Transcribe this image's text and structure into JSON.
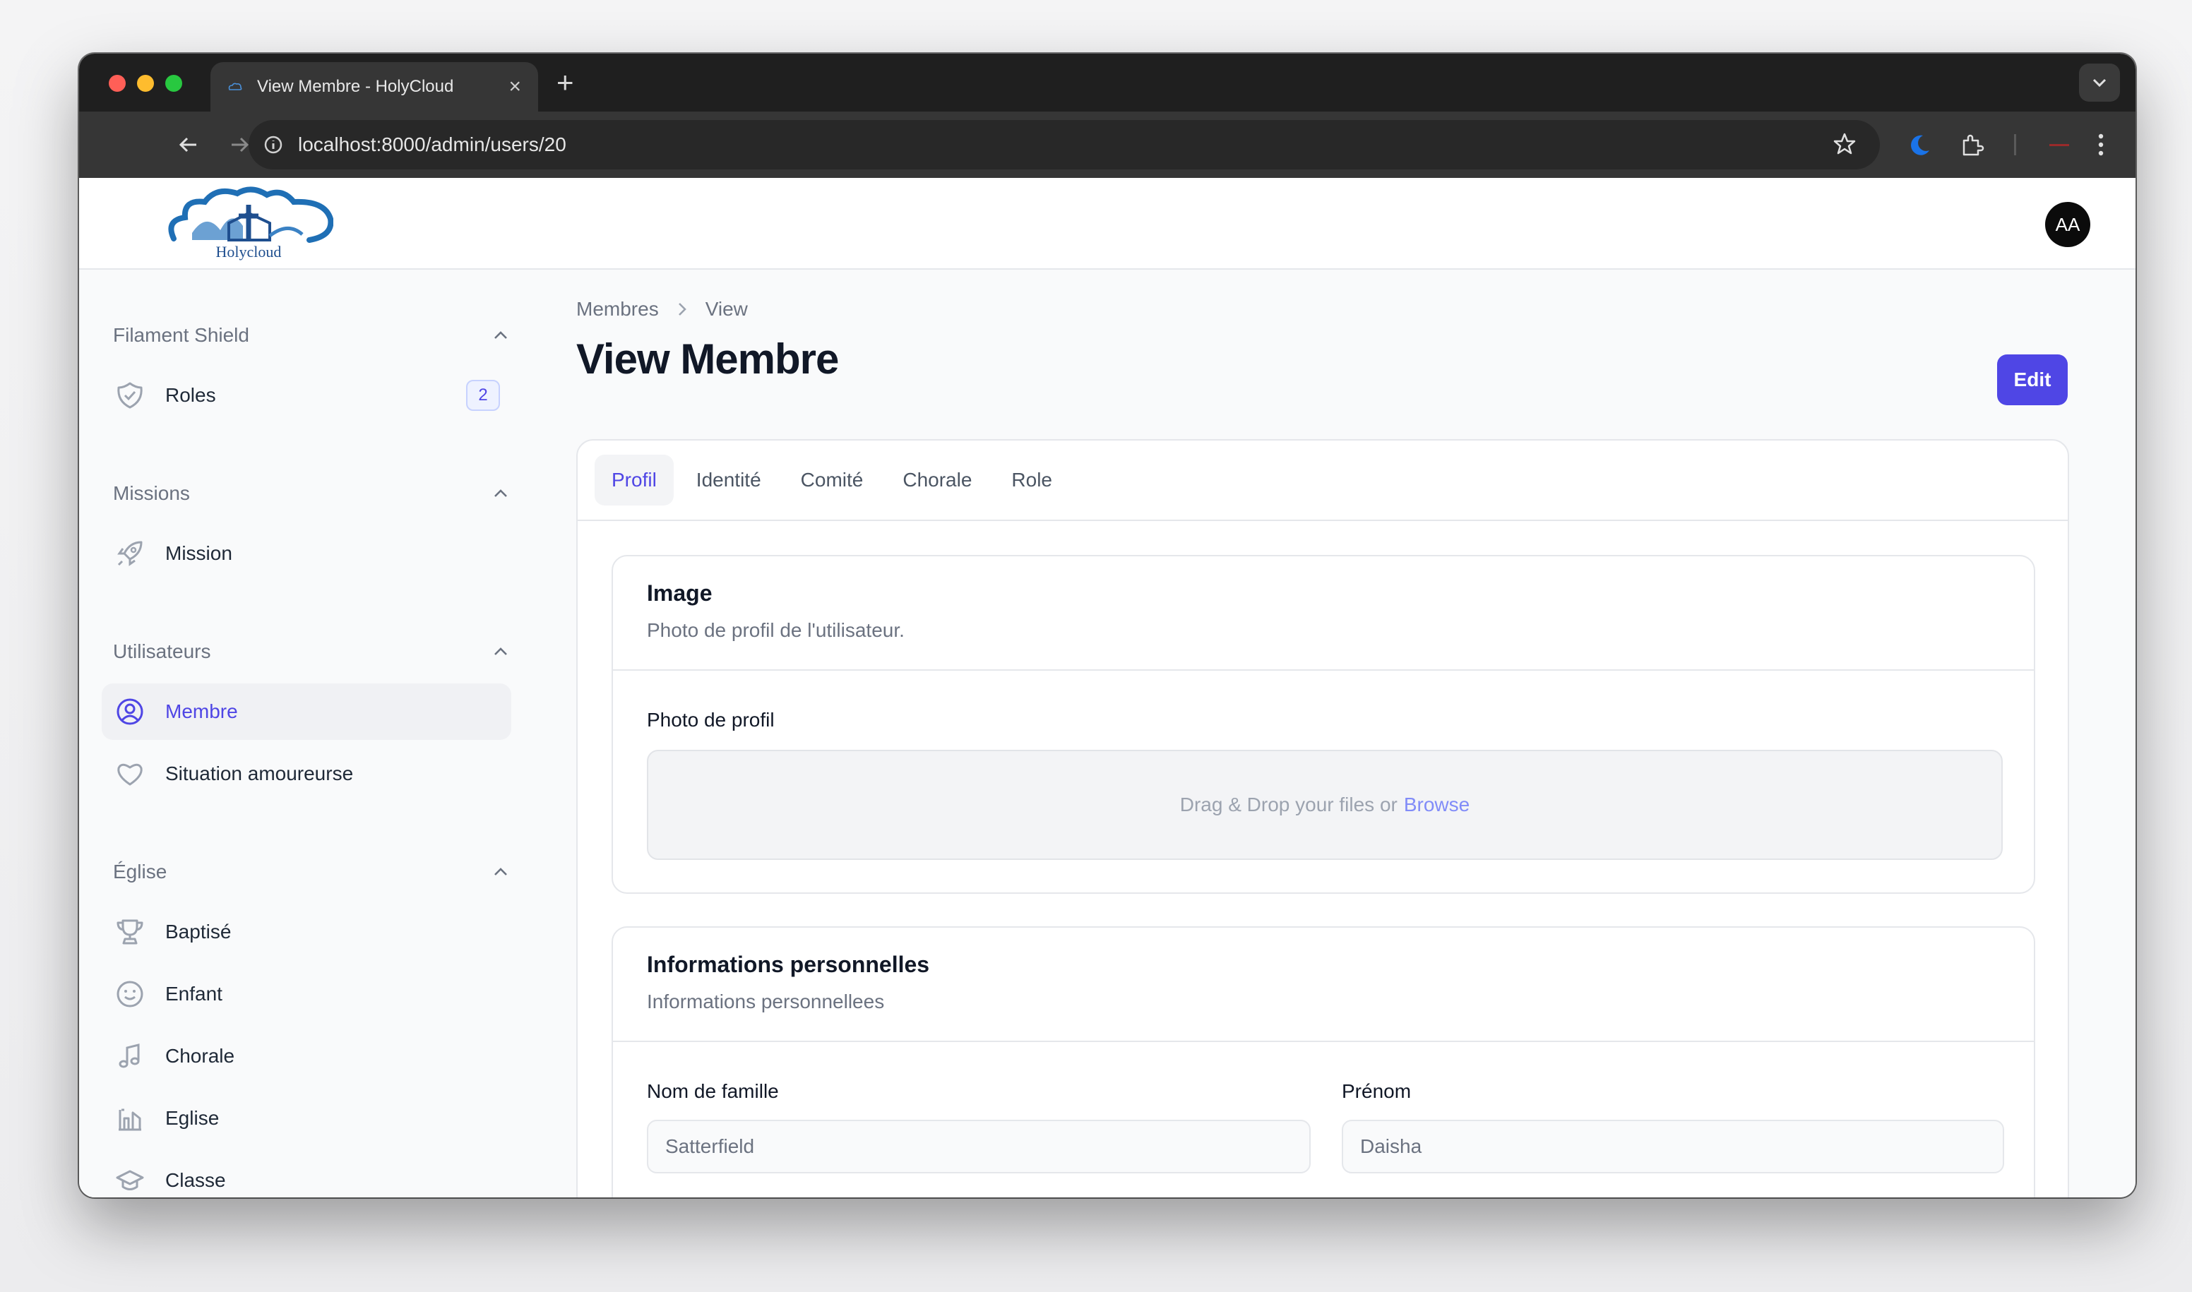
{
  "browser": {
    "tab_title": "View Membre - HolyCloud",
    "tab_close": "×",
    "new_tab": "+",
    "url": "localhost:8000/admin/users/20"
  },
  "header": {
    "logo_text": "Holycloud",
    "avatar_initials": "AA"
  },
  "sidebar": {
    "groups": [
      {
        "label": "Filament Shield",
        "items": [
          {
            "label": "Roles",
            "icon": "shield-check-icon",
            "badge": "2"
          }
        ]
      },
      {
        "label": "Missions",
        "items": [
          {
            "label": "Mission",
            "icon": "rocket-icon"
          }
        ]
      },
      {
        "label": "Utilisateurs",
        "items": [
          {
            "label": "Membre",
            "icon": "user-circle-icon",
            "active": true
          },
          {
            "label": "Situation amoureurse",
            "icon": "heart-icon"
          }
        ]
      },
      {
        "label": "Église",
        "items": [
          {
            "label": "Baptisé",
            "icon": "trophy-icon"
          },
          {
            "label": "Enfant",
            "icon": "face-smile-icon"
          },
          {
            "label": "Chorale",
            "icon": "musical-note-icon"
          },
          {
            "label": "Eglise",
            "icon": "building-library-icon"
          },
          {
            "label": "Classe",
            "icon": "academic-cap-icon"
          }
        ]
      }
    ]
  },
  "main": {
    "breadcrumb": [
      "Membres",
      "View"
    ],
    "title": "View Membre",
    "edit_label": "Edit",
    "tabs": [
      "Profil",
      "Identité",
      "Comité",
      "Chorale",
      "Role"
    ],
    "image_section": {
      "title": "Image",
      "description": "Photo de profil de l'utilisateur.",
      "field_label": "Photo de profil",
      "dropzone_text": "Drag & Drop your files or",
      "browse_label": "Browse"
    },
    "personal_section": {
      "title": "Informations personnelles",
      "description": "Informations personnellees",
      "fields": [
        {
          "label": "Nom de famille",
          "value": "Satterfield"
        },
        {
          "label": "Prénom",
          "value": "Daisha"
        }
      ]
    }
  },
  "colors": {
    "primary": "#4f46e5",
    "primary_light": "#818cf8",
    "browser_dark": "#1f1f1f",
    "browser_toolbar": "#363636"
  }
}
